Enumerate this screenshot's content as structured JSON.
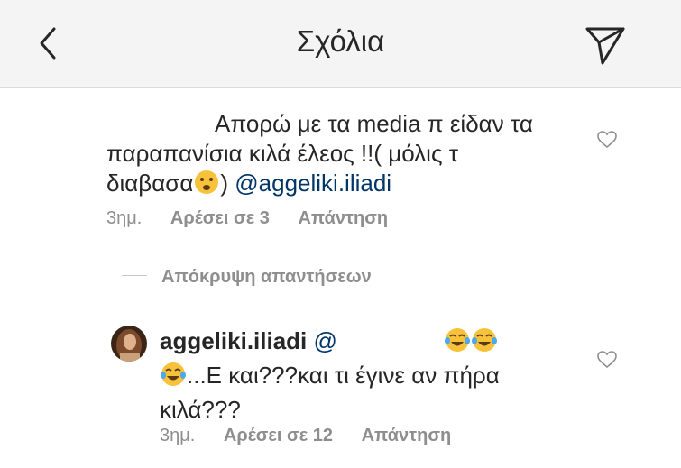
{
  "header": {
    "title": "Σχόλια",
    "back_icon": "chevron-left-icon",
    "share_icon": "paper-plane-icon"
  },
  "comment1": {
    "text_line1": "Απορώ με τα media π είδαν τα",
    "text_line2": "παραπανίσια κιλά έλεος !!( μόλις τ",
    "text_line3_pre": "διαβασα",
    "text_line3_post": ") ",
    "emoji": "frowning-face",
    "mention": "@aggeliki.iliadi",
    "time": "3ημ.",
    "likes": "Αρέσει σε 3",
    "reply": "Απάντηση"
  },
  "hide_replies": "Απόκρυψη απαντήσεων",
  "comment2": {
    "username": "aggeliki.iliadi",
    "mention_prefix": "@",
    "emoji": "tears-of-joy",
    "text_line2": "...Ε και???και τι έγινε αν πήρα",
    "text_line3": "κιλά???",
    "time": "3ημ.",
    "likes": "Αρέσει σε 12",
    "reply": "Απάντηση"
  },
  "colors": {
    "mention": "#003569",
    "meta": "#8e8e8e",
    "header_bg": "#f4f4f4"
  }
}
